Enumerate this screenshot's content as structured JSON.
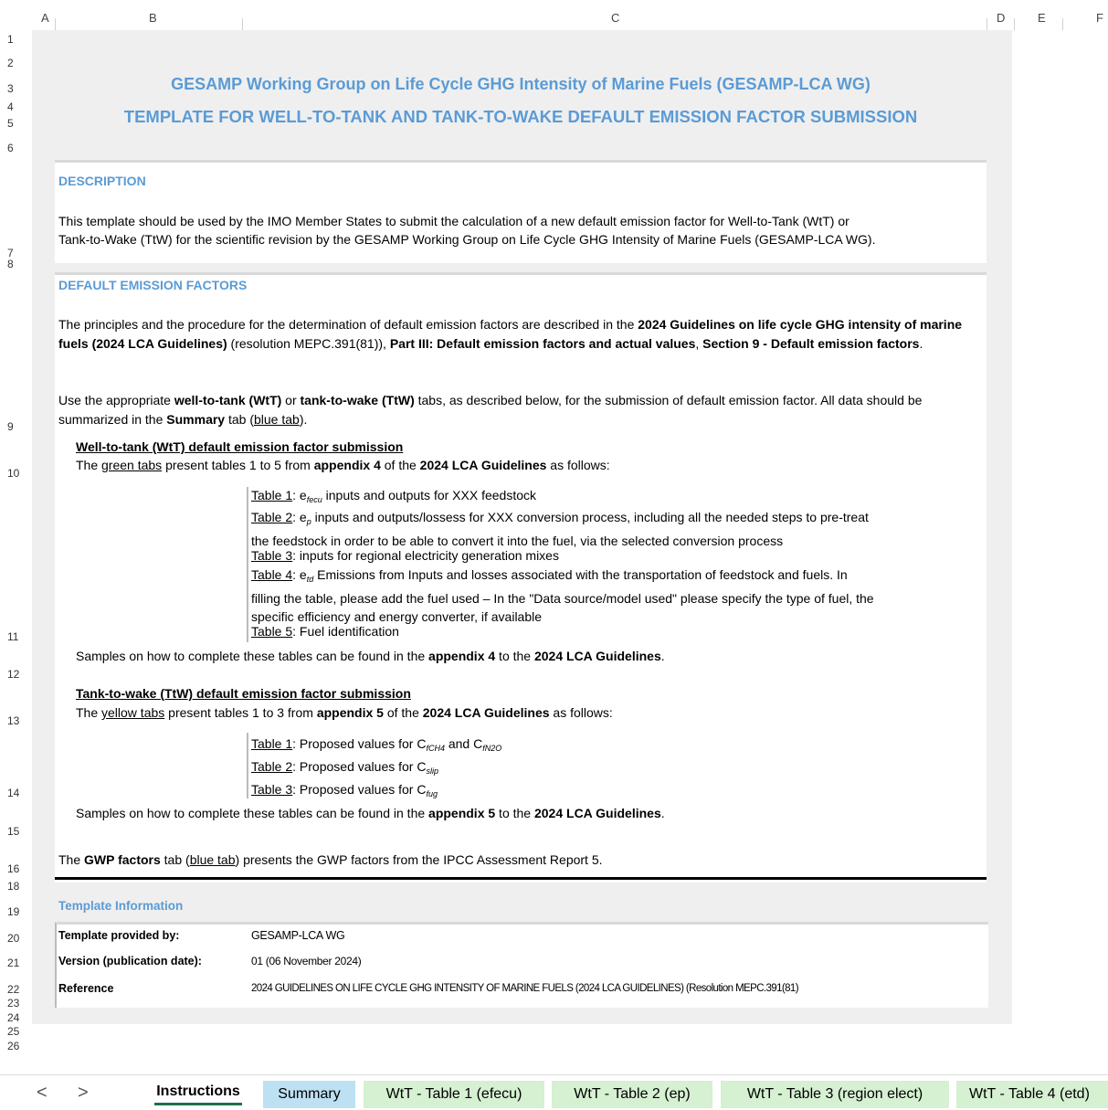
{
  "columns": [
    "A",
    "B",
    "C",
    "D",
    "E",
    "F"
  ],
  "rows": [
    "1",
    "2",
    "3",
    "4",
    "5",
    "6",
    "7",
    "8",
    "9",
    "10",
    "11",
    "12",
    "13",
    "14",
    "15",
    "16",
    "18",
    "19",
    "20",
    "21",
    "22",
    "23",
    "24",
    "25",
    "26"
  ],
  "title": {
    "line1": "GESAMP Working Group on Life Cycle GHG Intensity of Marine Fuels (GESAMP-LCA WG)",
    "line2": "TEMPLATE FOR WELL-TO-TANK AND TANK-TO-WAKE DEFAULT EMISSION FACTOR SUBMISSION"
  },
  "description": {
    "header": "DESCRIPTION",
    "line1": "This template should be used by the IMO Member States to submit the calculation of a new default emission factor for Well-to-Tank (WtT) or",
    "line2": "Tank-to-Wake (TtW) for the scientific revision by the GESAMP Working Group on Life Cycle GHG Intensity of Marine Fuels (GESAMP-LCA WG)."
  },
  "defaults": {
    "header": "DEFAULT EMISSION FACTORS",
    "p1_a": "The principles and the procedure for the determination of default emission factors are described in the ",
    "p1_b": "2024 Guidelines on life cycle GHG intensity of marine fuels (2024 LCA Guidelines)",
    "p1_c": " (resolution MEPC.391(81)), ",
    "p1_d": "Part III: Default emission factors and actual values",
    "p1_e": ", ",
    "p1_f": "Section 9 - Default emission factors",
    "p1_g": ".",
    "p2_a": "Use the appropriate ",
    "p2_b": "well-to-tank (WtT)",
    "p2_c": " or ",
    "p2_d": "tank-to-wake (TtW)",
    "p2_e": " tabs, as described below, for the submission of default emission factor. All data should be summarized in the ",
    "p2_f": "Summary",
    "p2_g": " tab (",
    "p2_h": "blue tab",
    "p2_i": ").",
    "wtt_heading": "Well-to-tank (WtT) default emission factor submission",
    "wtt_intro_a": "The ",
    "wtt_intro_b": "green tabs",
    "wtt_intro_c": " present tables 1 to 5 from ",
    "wtt_intro_d": "appendix 4",
    "wtt_intro_e": " of the ",
    "wtt_intro_f": "2024 LCA Guidelines",
    "wtt_intro_g": " as follows:",
    "t1_label": "Table 1",
    "t1_a": ": e",
    "t1_sub": "fecu",
    "t1_b": " inputs and outputs for XXX feedstock",
    "t2_label": "Table 2",
    "t2_a": ": e",
    "t2_sub": "p",
    "t2_b": " inputs and outputs/lossess for XXX conversion process, including all the needed steps to pre-treat",
    "t2_c": "the feedstock in order to be able to convert it into the fuel, via the selected conversion process",
    "t3_label": "Table 3",
    "t3_a": ": inputs for regional electricity generation mixes",
    "t4_label": "Table 4",
    "t4_a": ": e",
    "t4_sub": "td",
    "t4_b": " Emissions from Inputs and losses associated with the transportation of feedstock and fuels. In",
    "t4_c": "filling the table, please add the fuel used – In the \"Data source/model used\" please specify the type of fuel, the",
    "t4_d": "specific efficiency and energy converter, if available",
    "t5_label": "Table 5",
    "t5_a": ": Fuel identification",
    "wtt_samples_a": "Samples on how to complete these tables can be found in the ",
    "wtt_samples_b": "appendix 4",
    "wtt_samples_c": " to the ",
    "wtt_samples_d": "2024 LCA Guidelines",
    "wtt_samples_e": ".",
    "ttw_heading": "Tank-to-wake (TtW) default emission factor submission",
    "ttw_intro_a": "The ",
    "ttw_intro_b": "yellow tabs",
    "ttw_intro_c": " present tables 1 to 3 from ",
    "ttw_intro_d": "appendix 5",
    "ttw_intro_e": " of the ",
    "ttw_intro_f": "2024 LCA Guidelines",
    "ttw_intro_g": " as follows:",
    "tt1_label": "Table 1",
    "tt1_a": ": Proposed values for C",
    "tt1_sub1": "fCH4",
    "tt1_b": " and C",
    "tt1_sub2": "fN2O",
    "tt2_label": "Table 2",
    "tt2_a": ": Proposed values for C",
    "tt2_sub": "slip",
    "tt3_label": "Table 3",
    "tt3_a": ": Proposed values for C",
    "tt3_sub": "fug",
    "ttw_samples_a": "Samples on how to complete these tables can be found in the ",
    "ttw_samples_b": "appendix 5",
    "ttw_samples_c": " to the ",
    "ttw_samples_d": "2024 LCA Guidelines",
    "ttw_samples_e": ".",
    "gwp_a": "The ",
    "gwp_b": "GWP factors",
    "gwp_c": " tab (",
    "gwp_d": "blue tab",
    "gwp_e": ") presents the GWP factors from the  IPCC Assessment Report 5."
  },
  "template_info": {
    "header": "Template Information",
    "rows": [
      {
        "label": "Template provided by:",
        "value": "GESAMP-LCA WG"
      },
      {
        "label": "Version (publication date):",
        "value": "01 (06 November 2024)"
      },
      {
        "label": "Reference",
        "value": "2024 GUIDELINES ON LIFE CYCLE GHG INTENSITY OF MARINE FUELS (2024 LCA GUIDELINES) (Resolution MEPC.391(81)"
      }
    ]
  },
  "tabs": {
    "prev": "<",
    "next": ">",
    "items": [
      {
        "label": "Instructions",
        "bg": "#ffffff"
      },
      {
        "label": "Summary",
        "bg": "#bde0f2"
      },
      {
        "label": "WtT - Table 1 (efecu)",
        "bg": "#d6f0d2"
      },
      {
        "label": "WtT - Table 2 (ep)",
        "bg": "#d6f0d2"
      },
      {
        "label": "WtT - Table 3 (region elect)",
        "bg": "#d6f0d2"
      },
      {
        "label": "WtT - Table 4 (etd)",
        "bg": "#d6f0d2"
      }
    ]
  },
  "colors": {
    "heading_blue": "#5b9bd5",
    "sheet_bg": "#efefef",
    "active_tab_underline": "#1e7145"
  }
}
